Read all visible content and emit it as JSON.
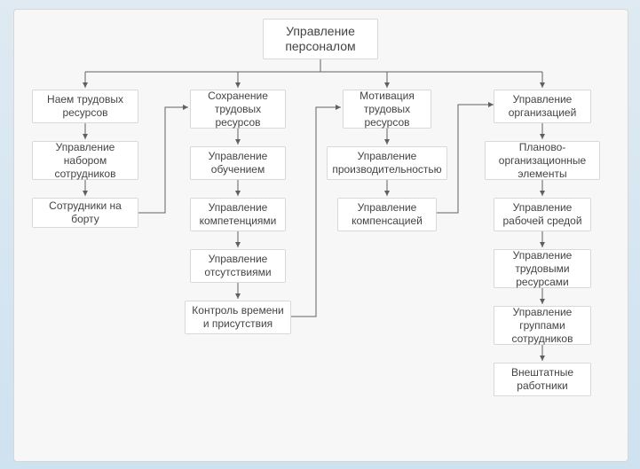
{
  "root": "Управление персоналом",
  "col1": {
    "a": "Наем трудовых ресурсов",
    "b": "Управление набором сотрудников",
    "c": "Сотрудники на борту"
  },
  "col2": {
    "a": "Сохранение трудовых ресурсов",
    "b": "Управление обучением",
    "c": "Управление компетенциями",
    "d": "Управление отсутствиями",
    "e": "Контроль времени и присутствия"
  },
  "col3": {
    "a": "Мотивация трудовых ресурсов",
    "b": "Управление производительностью",
    "c": "Управление компенсацией"
  },
  "col4": {
    "a": "Управление организацией",
    "b": "Планово-организационные элементы",
    "c": "Управление рабочей средой",
    "d": "Управление трудовыми ресурсами",
    "e": "Управление группами сотрудников",
    "f": "Внештатные работники"
  }
}
